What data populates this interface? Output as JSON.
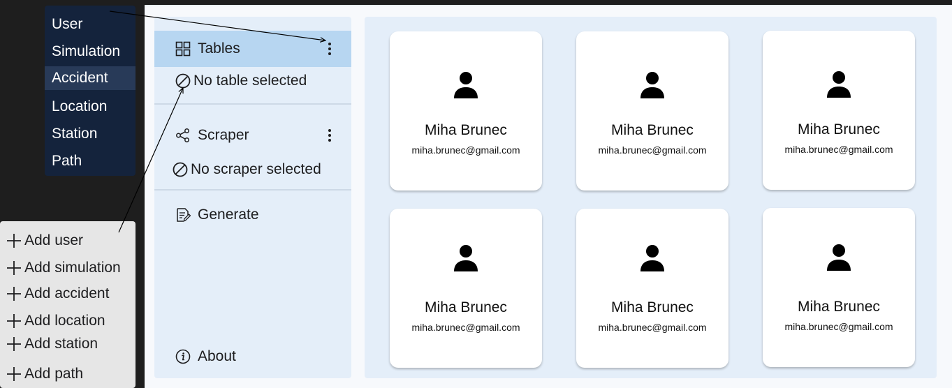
{
  "sidebar": {
    "tables_label": "Tables",
    "no_table": "No table selected",
    "scraper_label": "Scraper",
    "no_scraper": "No scraper selected",
    "generate_label": "Generate",
    "about_label": "About"
  },
  "cards": [
    {
      "name": "Miha Brunec",
      "email": "miha.brunec@gmail.com"
    },
    {
      "name": "Miha Brunec",
      "email": "miha.brunec@gmail.com"
    },
    {
      "name": "Miha Brunec",
      "email": "miha.brunec@gmail.com"
    },
    {
      "name": "Miha Brunec",
      "email": "miha.brunec@gmail.com"
    },
    {
      "name": "Miha Brunec",
      "email": "miha.brunec@gmail.com"
    },
    {
      "name": "Miha Brunec",
      "email": "miha.brunec@gmail.com"
    }
  ],
  "tables_menu": {
    "items": [
      "User",
      "Simulation",
      "Accident",
      "Location",
      "Station",
      "Path"
    ],
    "highlighted": "Accident"
  },
  "add_menu": {
    "items": [
      "Add user",
      "Add simulation",
      "Add accident",
      "Add location",
      "Add station",
      "Add path"
    ]
  },
  "icons": {
    "tables": "grid-icon",
    "no_table": "prohibited-icon",
    "scraper": "share-icon",
    "no_scraper": "prohibited-icon",
    "generate": "document-edit-icon",
    "about": "info-icon",
    "more": "more-vertical-icon",
    "card_avatar": "person-icon",
    "add": "plus-icon"
  },
  "colors": {
    "active_nav": "#b7d6f1",
    "sidebar_bg": "#e4eef9",
    "menu_dark": "#14233c",
    "menu_highlight": "#283a58"
  }
}
